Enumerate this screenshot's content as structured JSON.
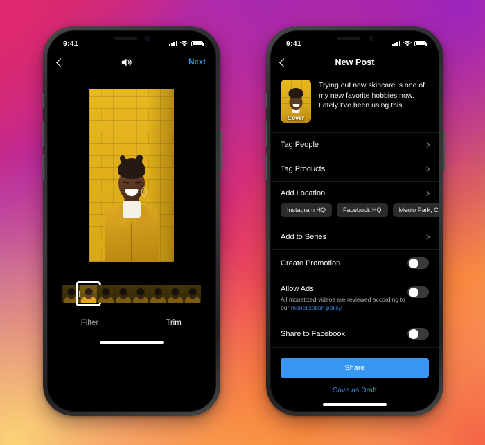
{
  "statusbar": {
    "time": "9:41",
    "signal_icon": "signal-bars-icon",
    "wifi_icon": "wifi-icon",
    "battery_icon": "battery-icon"
  },
  "left_phone": {
    "nav": {
      "back_icon": "chevron-left-icon",
      "sound_icon": "speaker-on-icon",
      "next_label": "Next"
    },
    "editor": {
      "media_type": "video-preview",
      "selected_frame_index": 1,
      "frame_count": 8
    },
    "tabs": [
      {
        "label": "Filter",
        "selected": false
      },
      {
        "label": "Trim",
        "selected": true
      }
    ]
  },
  "right_phone": {
    "nav": {
      "back_icon": "chevron-left-icon",
      "title": "New Post"
    },
    "cover": {
      "badge": "Cover"
    },
    "caption": "Trying out new skincare is one of my new favorite hobbies now. Lately I've been using this",
    "rows": [
      {
        "label": "Tag People",
        "type": "disclosure"
      },
      {
        "label": "Tag Products",
        "type": "disclosure"
      },
      {
        "label": "Add Location",
        "type": "disclosure"
      }
    ],
    "location_chips": [
      "Instagram HQ",
      "Facebook HQ",
      "Menlo Park, CA"
    ],
    "series_row": {
      "label": "Add to Series",
      "type": "disclosure"
    },
    "toggles": [
      {
        "label": "Create Promotion",
        "on": false
      },
      {
        "label": "Allow Ads",
        "on": false,
        "sub_prefix": "All monetized videos are reviewed according to our ",
        "sub_link": "monetization policy",
        "sub_suffix": "."
      },
      {
        "label": "Share to Facebook",
        "on": false
      }
    ],
    "share_label": "Share",
    "draft_label": "Save as Draft"
  },
  "colors": {
    "accent_blue": "#3897f0",
    "link_blue": "#3d82d6",
    "sheet_bg": "#000000"
  }
}
